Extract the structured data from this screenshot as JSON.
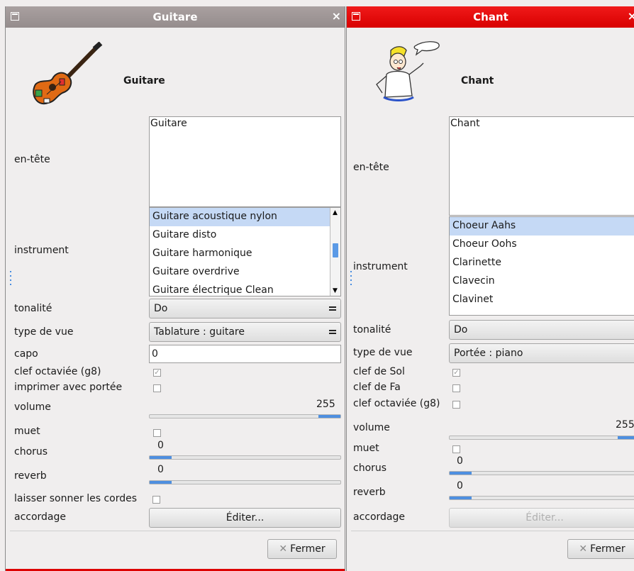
{
  "windows": [
    {
      "title": "Guitare",
      "close": "×",
      "header": "Guitare",
      "labels": {
        "entete": "en-tête",
        "instrument": "instrument",
        "tonalite": "tonalité",
        "type_vue": "type de vue",
        "capo": "capo",
        "clef_g8": "clef octaviée (g8)",
        "imprimer": "imprimer avec portée",
        "volume": "volume",
        "muet": "muet",
        "chorus": "chorus",
        "reverb": "reverb",
        "laisser": "laisser sonner les cordes",
        "accordage": "accordage"
      },
      "entete_value": "Guitare",
      "instruments": [
        "Guitare acoustique nylon",
        "Guitare disto",
        "Guitare harmonique",
        "Guitare overdrive",
        "Guitare électrique Clean"
      ],
      "selected_instrument": "Guitare acoustique nylon",
      "tonalite": "Do",
      "type_vue": "Tablature : guitare",
      "capo": "0",
      "clef_g8_checked": true,
      "imprimer_checked": false,
      "volume": "255",
      "volume_fraction": 1.0,
      "muet_checked": false,
      "chorus": "0",
      "reverb": "0",
      "laisser_checked": false,
      "accordage_button": "Éditer...",
      "close_button": "Fermer",
      "icon": "guitar-icon"
    },
    {
      "title": "Chant",
      "close": "×",
      "header": "Chant",
      "labels": {
        "entete": "en-tête",
        "instrument": "instrument",
        "tonalite": "tonalité",
        "type_vue": "type de vue",
        "clef_sol": "clef de Sol",
        "clef_fa": "clef de Fa",
        "clef_g8": "clef octaviée (g8)",
        "volume": "volume",
        "muet": "muet",
        "chorus": "chorus",
        "reverb": "reverb",
        "accordage": "accordage"
      },
      "entete_value": "Chant",
      "instruments": [
        "Choeur Aahs",
        "Choeur Oohs",
        "Clarinette",
        "Clavecin",
        "Clavinet"
      ],
      "selected_instrument": "Choeur Aahs",
      "tonalite": "Do",
      "type_vue": "Portée : piano",
      "clef_sol_checked": true,
      "clef_fa_checked": false,
      "clef_g8_checked": false,
      "volume": "255",
      "volume_fraction": 1.0,
      "muet_checked": false,
      "chorus": "0",
      "reverb": "0",
      "accordage_button": "Éditer...",
      "close_button": "Fermer",
      "icon": "singer-icon"
    }
  ],
  "colors": {
    "guitar_titlebar": "#9e9595",
    "chant_titlebar": "#e00000",
    "selection": "#c5d9f5",
    "slider_fill": "#4e8fe0"
  }
}
